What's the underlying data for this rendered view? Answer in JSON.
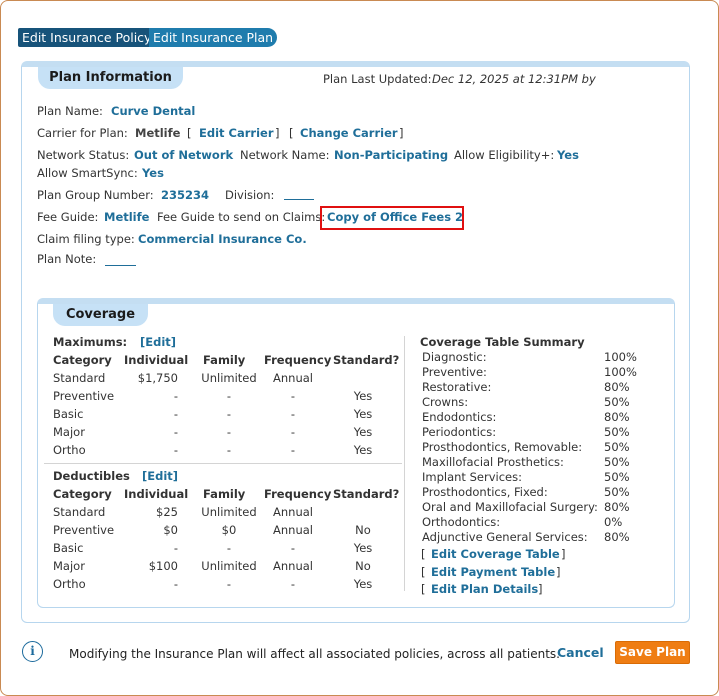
{
  "tabs": [
    "Edit Insurance Policy",
    "Edit Insurance Plan"
  ],
  "plan_info": {
    "heading": "Plan Information",
    "last_updated_label": "Plan Last Updated:",
    "last_updated_value": "Dec 12, 2025 at 12:31PM by",
    "plan_name_label": "Plan Name:",
    "plan_name": "Curve Dental",
    "carrier_label": "Carrier for Plan:",
    "carrier": "Metlife",
    "edit_carrier": "Edit Carrier",
    "change_carrier": "Change Carrier",
    "network_status_label": "Network Status:",
    "network_status": "Out of Network",
    "network_name_label": "Network Name:",
    "network_name": "Non-Participating",
    "allow_elig_label": "Allow Eligibility+:",
    "allow_elig": "Yes",
    "allow_smartsync_label": "Allow SmartSync:",
    "allow_smartsync": "Yes",
    "group_number_label": "Plan Group Number:",
    "group_number": "235234",
    "division_label": "Division:",
    "fee_guide_label": "Fee Guide:",
    "fee_guide": "Metlife",
    "claims_fee_guide_label": "Fee Guide to send on Claims:",
    "claims_fee_guide": "Copy of Office Fees 2",
    "claim_filing_label": "Claim filing type:",
    "claim_filing": "Commercial Insurance Co.",
    "plan_note_label": "Plan Note:"
  },
  "coverage": {
    "heading": "Coverage",
    "edit": "[Edit]",
    "columns": [
      "Category",
      "Individual",
      "Family",
      "Frequency",
      "Standard?"
    ],
    "maximums": {
      "title": "Maximums:",
      "rows": [
        [
          "Standard",
          "$1,750",
          "Unlimited",
          "Annual",
          ""
        ],
        [
          "Preventive",
          "-",
          "-",
          "-",
          "Yes"
        ],
        [
          "Basic",
          "-",
          "-",
          "-",
          "Yes"
        ],
        [
          "Major",
          "-",
          "-",
          "-",
          "Yes"
        ],
        [
          "Ortho",
          "-",
          "-",
          "-",
          "Yes"
        ]
      ]
    },
    "deductibles": {
      "title": "Deductibles",
      "rows": [
        [
          "Standard",
          "$25",
          "Unlimited",
          "Annual",
          ""
        ],
        [
          "Preventive",
          "$0",
          "$0",
          "Annual",
          "No"
        ],
        [
          "Basic",
          "-",
          "-",
          "-",
          "Yes"
        ],
        [
          "Major",
          "$100",
          "Unlimited",
          "Annual",
          "No"
        ],
        [
          "Ortho",
          "-",
          "-",
          "-",
          "Yes"
        ]
      ]
    },
    "summary_title": "Coverage Table Summary",
    "summary": [
      [
        "Diagnostic:",
        "100%"
      ],
      [
        "Preventive:",
        "100%"
      ],
      [
        "Restorative:",
        "80%"
      ],
      [
        "Crowns:",
        "50%"
      ],
      [
        "Endodontics:",
        "80%"
      ],
      [
        "Periodontics:",
        "50%"
      ],
      [
        "Prosthodontics, Removable:",
        "50%"
      ],
      [
        "Maxillofacial Prosthetics:",
        "50%"
      ],
      [
        "Implant Services:",
        "50%"
      ],
      [
        "Prosthodontics, Fixed:",
        "50%"
      ],
      [
        "Oral and Maxillofacial Surgery:",
        "80%"
      ],
      [
        "Orthodontics:",
        "0%"
      ],
      [
        "Adjunctive General Services:",
        "80%"
      ]
    ],
    "edit_coverage_table": "Edit Coverage Table",
    "edit_payment_table": "Edit Payment Table",
    "edit_plan_details": "Edit Plan Details"
  },
  "footer": {
    "message": "Modifying the Insurance Plan will affect all associated policies, across all patients.",
    "cancel": "Cancel",
    "save": "Save Plan"
  }
}
